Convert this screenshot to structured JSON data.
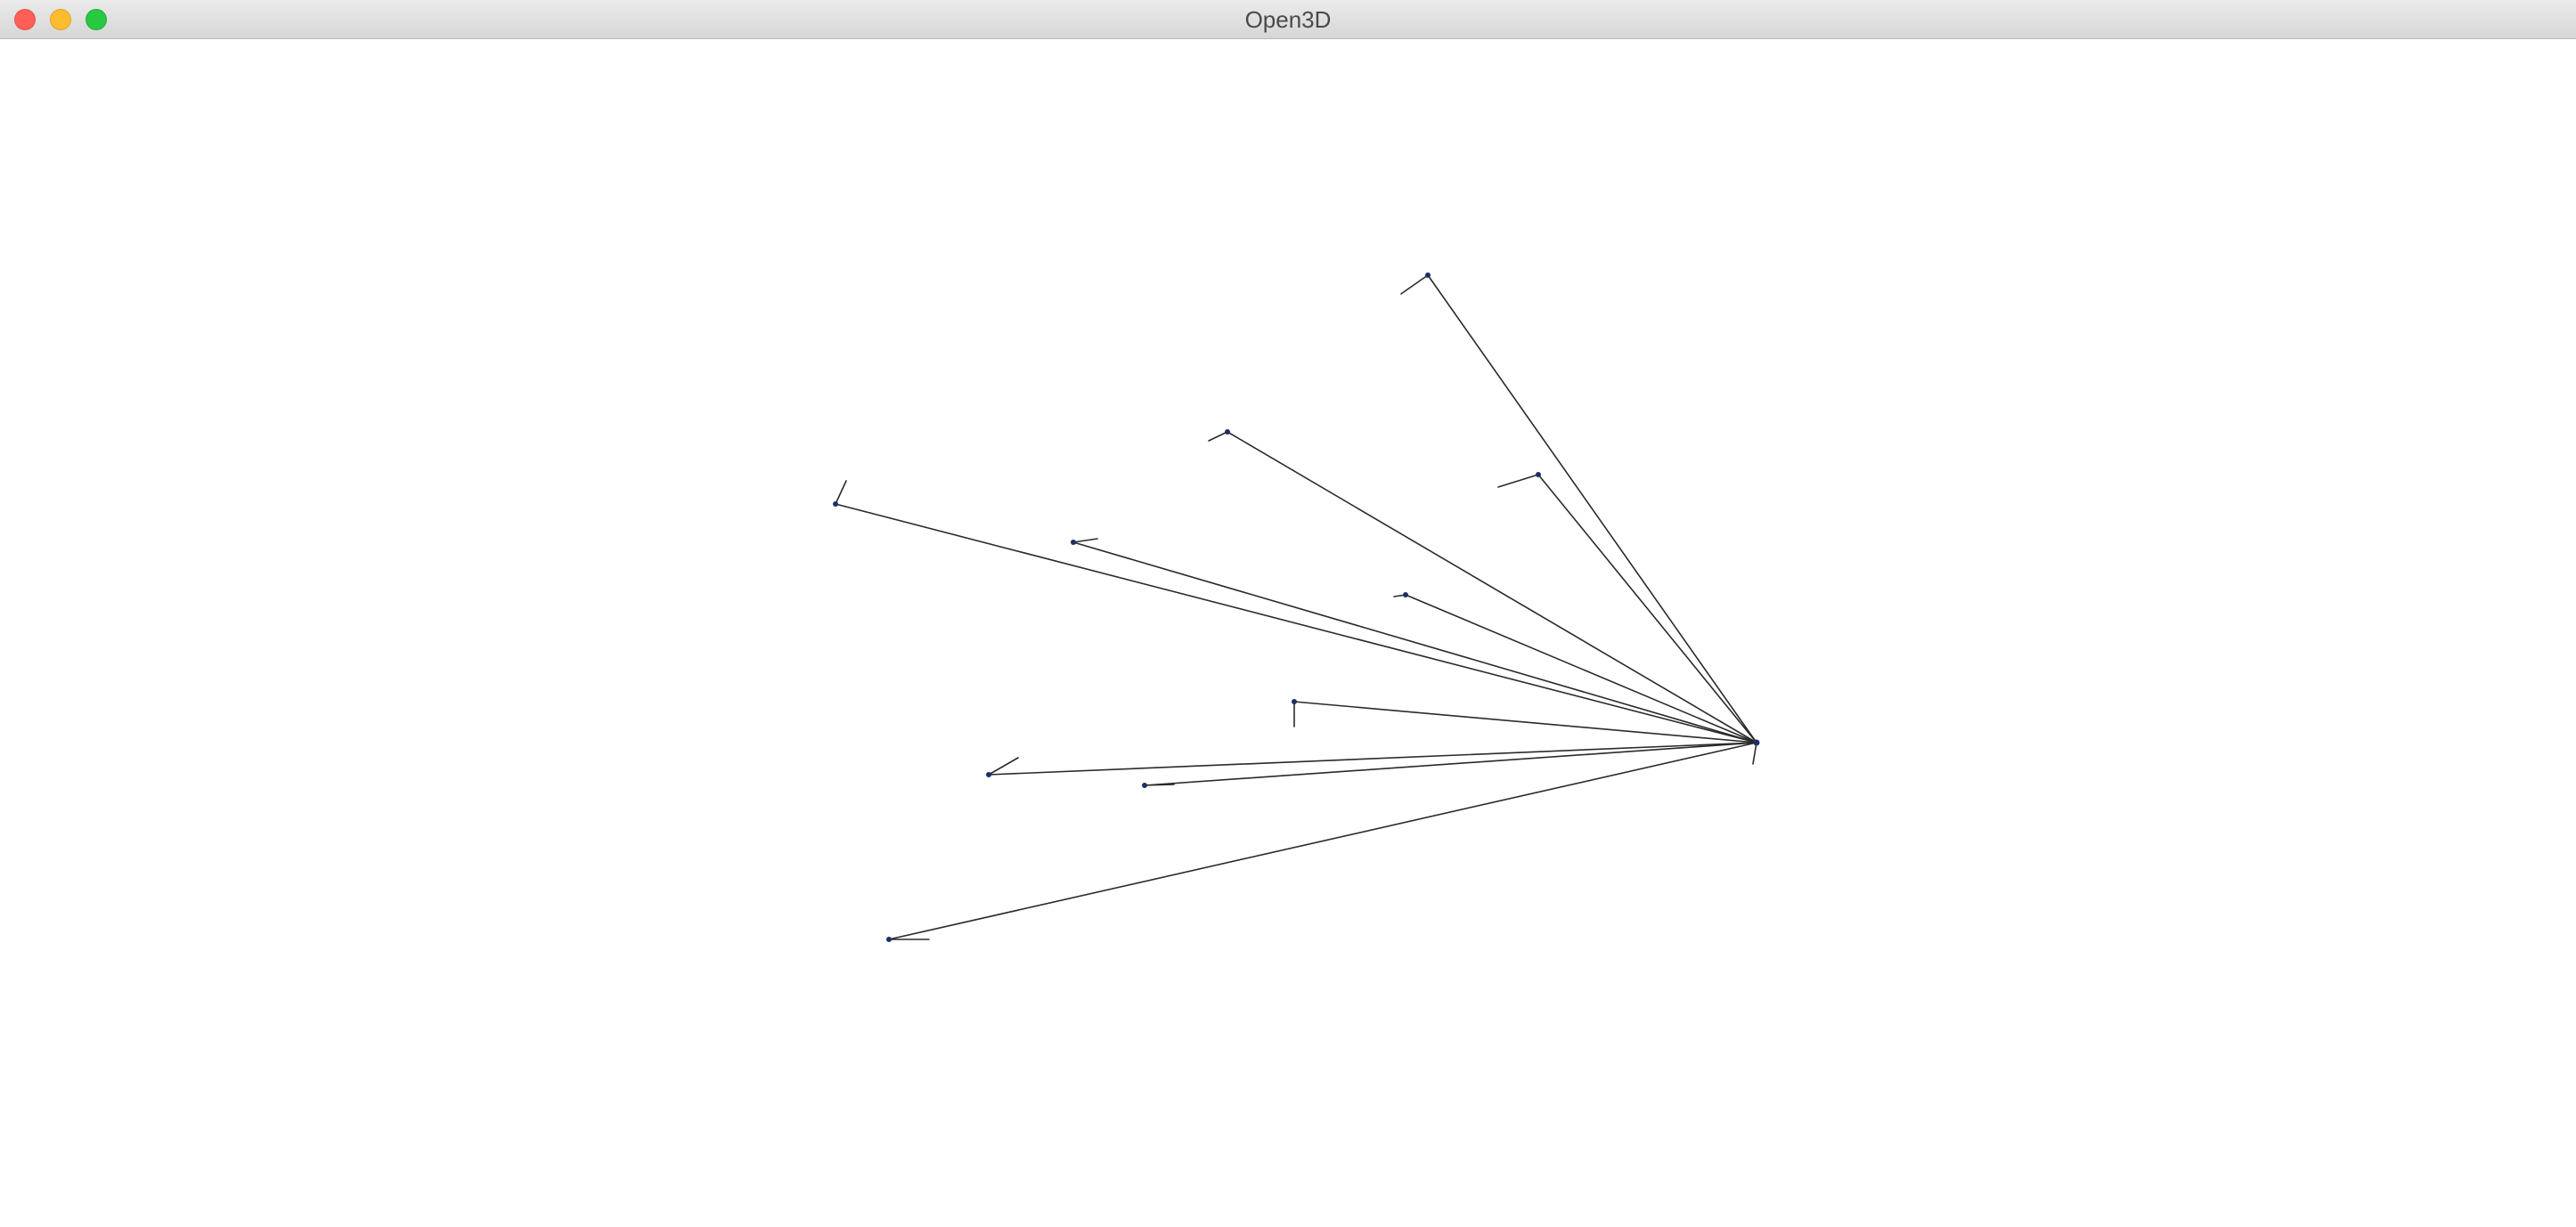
{
  "window": {
    "title": "Open3D",
    "controls": {
      "close_color": "#ff5f57",
      "minimize_color": "#febc2e",
      "zoom_color": "#28c840"
    }
  }
}
